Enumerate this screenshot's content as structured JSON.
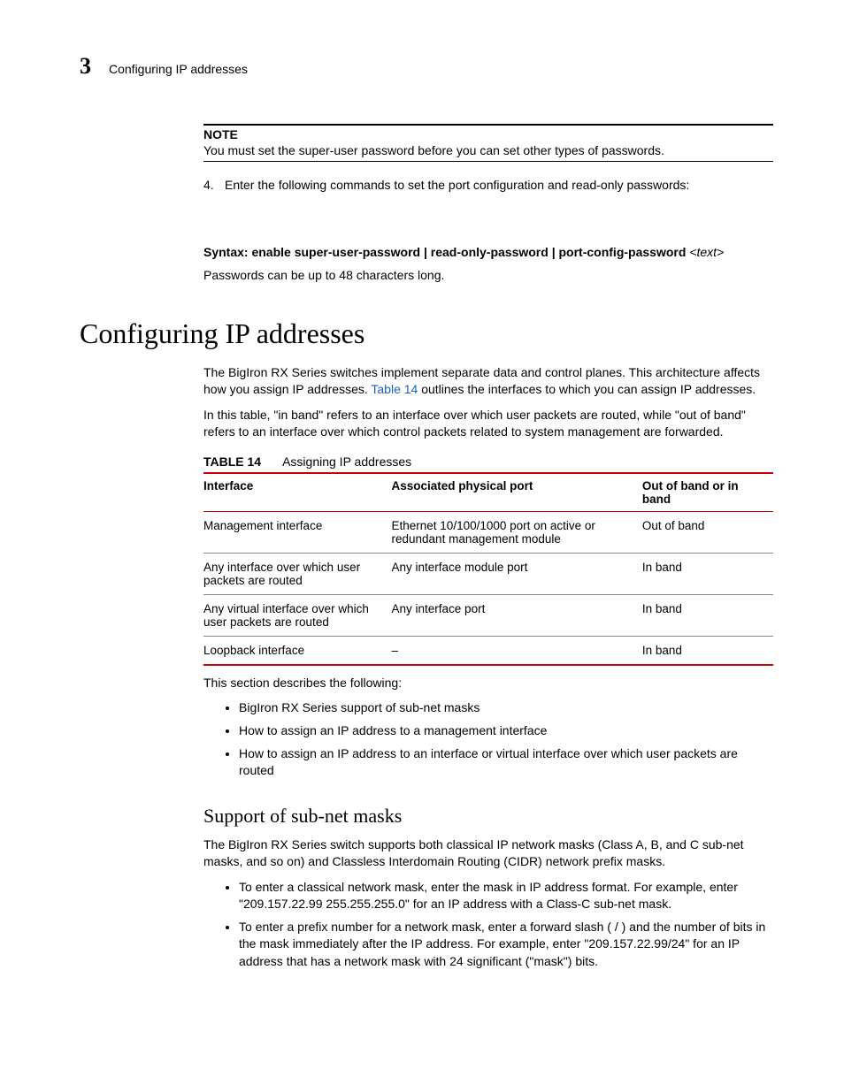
{
  "header": {
    "chapter_number": "3",
    "running_title": "Configuring IP addresses"
  },
  "note": {
    "label": "NOTE",
    "text": "You must set the super-user password before you can set other types of passwords."
  },
  "step4": {
    "number": "4.",
    "text": "Enter the following commands to set the port configuration and read-only passwords:"
  },
  "syntax": {
    "prefix": "Syntax:  ",
    "bold": "enable super-user-password | read-only-password | port-config-password",
    "italic": " <text>"
  },
  "pw_note": "Passwords can be up to 48 characters long.",
  "h1": "Configuring IP addresses",
  "intro1a": "The BigIron RX Series switches implement separate data and control planes. This architecture affects how you assign IP addresses. ",
  "intro1_link": "Table 14",
  "intro1b": " outlines the interfaces to which you can assign IP addresses.",
  "intro2": "In this table, \"in band\" refers to an interface over which user packets are routed, while \"out of band\" refers to an interface over which control packets related to system management are forwarded.",
  "table": {
    "number": "TABLE 14",
    "title": "Assigning IP addresses",
    "headers": [
      "Interface",
      "Associated physical port",
      "Out of band or in band"
    ],
    "rows": [
      [
        "Management interface",
        "Ethernet 10/100/1000 port on active or redundant management module",
        "Out of band"
      ],
      [
        "Any interface over which user packets are routed",
        "Any interface module port",
        "In band"
      ],
      [
        "Any virtual interface over which user packets are routed",
        "Any interface port",
        "In band"
      ],
      [
        "Loopback interface",
        "–",
        "In band"
      ]
    ]
  },
  "section_intro": "This section describes the following:",
  "section_bullets": [
    "BigIron RX Series support of sub-net masks",
    "How to assign an IP address to a management interface",
    "How to assign an IP address to an interface or virtual interface over which user packets are routed"
  ],
  "h2": "Support of sub-net masks",
  "sub_p": "The BigIron RX Series switch supports both classical IP network masks (Class A, B, and C sub-net masks, and so on) and Classless Interdomain Routing (CIDR) network prefix masks.",
  "sub_bullets": [
    "To enter a classical network mask, enter the mask in IP address format. For example, enter \"209.157.22.99 255.255.255.0\" for an IP address with a Class-C sub-net mask.",
    "To enter a prefix number for a network mask, enter a forward slash ( / ) and the number of bits in the mask immediately after the IP address. For example, enter \"209.157.22.99/24\" for an IP address that has a network mask with 24 significant (\"mask\") bits."
  ]
}
